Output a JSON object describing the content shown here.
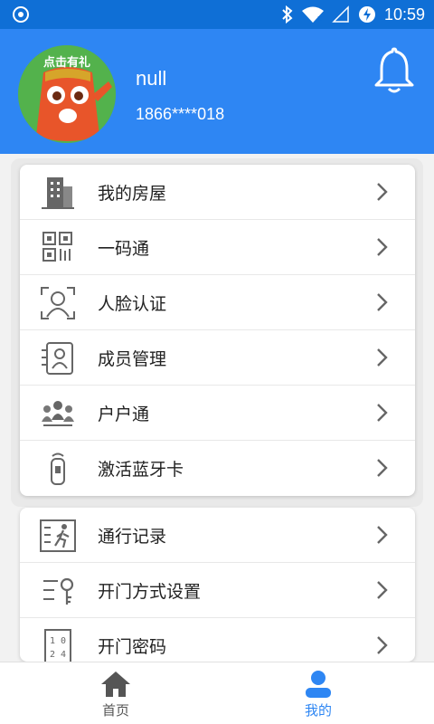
{
  "status_bar": {
    "time": "10:59"
  },
  "profile": {
    "avatar_promo": "点击有礼",
    "username": "null",
    "phone": "1866****018"
  },
  "menu_group_1": [
    {
      "label": "我的房屋",
      "icon": "building-icon"
    },
    {
      "label": "一码通",
      "icon": "qr-code-icon"
    },
    {
      "label": "人脸认证",
      "icon": "face-scan-icon"
    },
    {
      "label": "成员管理",
      "icon": "member-card-icon"
    },
    {
      "label": "户户通",
      "icon": "people-group-icon"
    },
    {
      "label": "激活蓝牙卡",
      "icon": "bluetooth-card-icon"
    }
  ],
  "menu_group_2": [
    {
      "label": "通行记录",
      "icon": "access-record-icon"
    },
    {
      "label": "开门方式设置",
      "icon": "key-settings-icon"
    },
    {
      "label": "开门密码",
      "icon": "door-password-icon"
    }
  ],
  "tabs": [
    {
      "label": "首页",
      "icon": "home-icon"
    },
    {
      "label": "我的",
      "icon": "user-icon"
    }
  ],
  "colors": {
    "primary": "#2e86f3",
    "status_bar": "#0f6fd6",
    "text": "#222222",
    "icon_gray": "#666666"
  }
}
